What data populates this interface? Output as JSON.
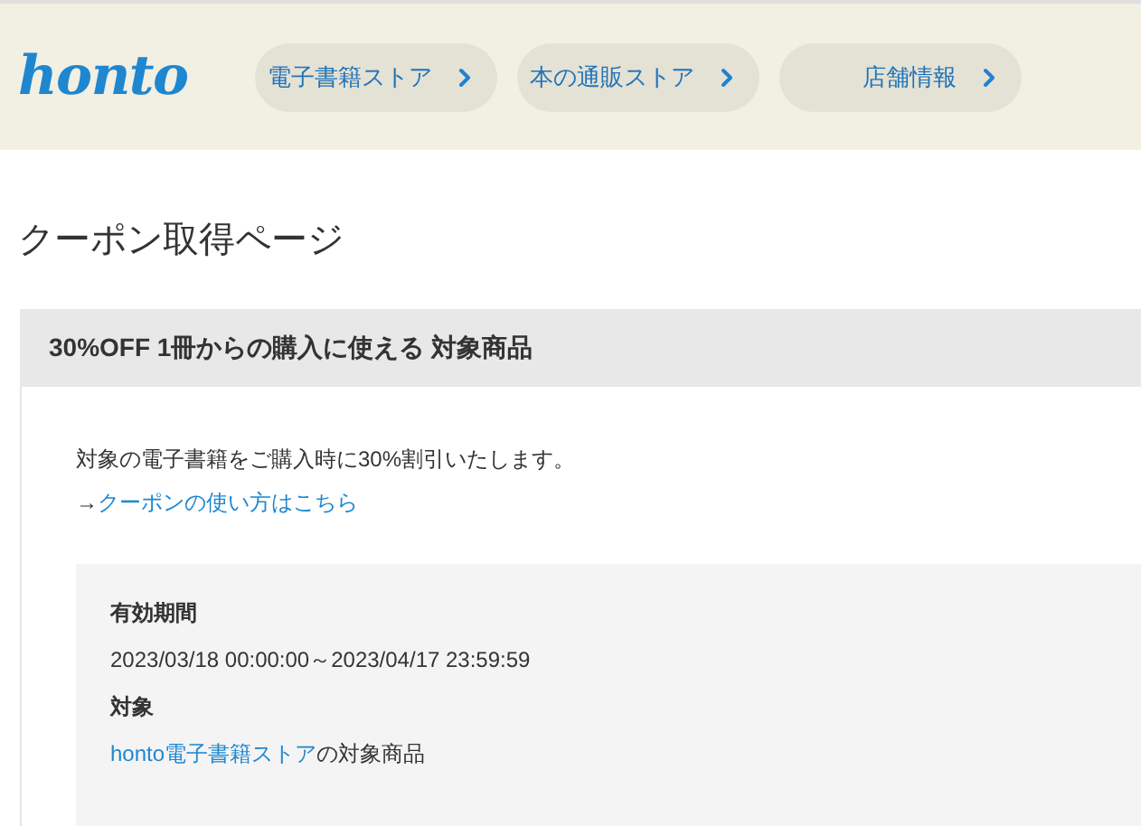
{
  "header": {
    "logo": "honto",
    "nav": [
      {
        "label": "電子書籍ストア"
      },
      {
        "label": "本の通販ストア"
      },
      {
        "label": "店舗情報"
      }
    ]
  },
  "page_title": "クーポン取得ページ",
  "coupon": {
    "heading": "30%OFF 1冊からの購入に使える 対象商品",
    "description": "対象の電子書籍をご購入時に30%割引いたします。",
    "how_to": {
      "arrow": "→",
      "link": "クーポンの使い方はこちら"
    },
    "details": [
      {
        "label": "有効期間",
        "value": "2023/03/18 00:00:00～2023/04/17 23:59:59"
      },
      {
        "label": "対象",
        "link": "honto電子書籍ストア",
        "value": "の対象商品"
      }
    ]
  }
}
